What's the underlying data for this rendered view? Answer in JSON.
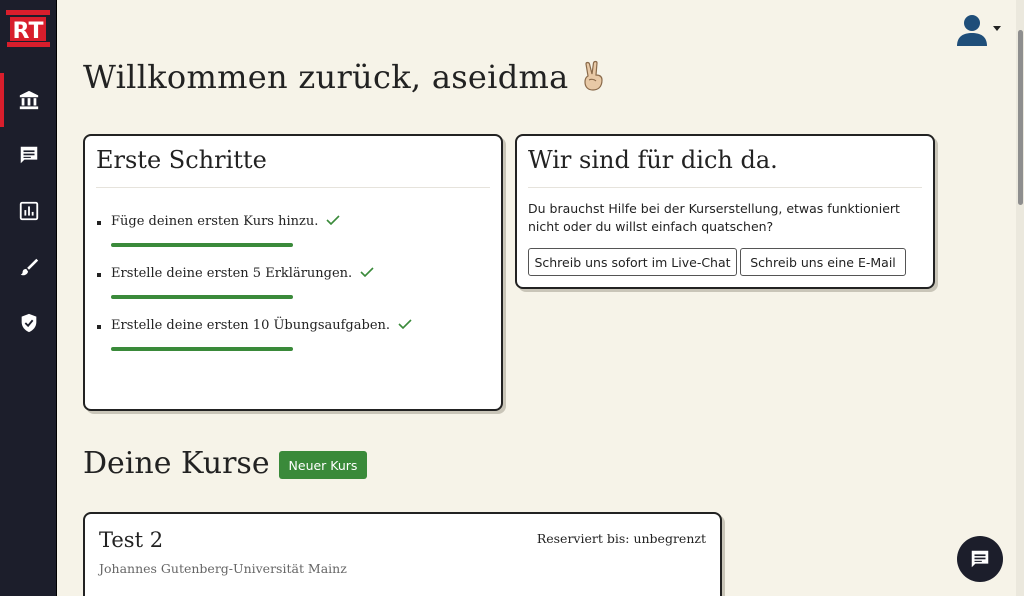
{
  "brand": {
    "logo": "RT",
    "accent_color": "#d81e2c",
    "sidebar_color": "#1c1e2b"
  },
  "sidebar": {
    "items": [
      {
        "icon": "institution-icon",
        "active": true
      },
      {
        "icon": "chat-icon",
        "active": false
      },
      {
        "icon": "chart-icon",
        "active": false
      },
      {
        "icon": "brush-icon",
        "active": false
      },
      {
        "icon": "shield-check-icon",
        "active": false
      }
    ]
  },
  "header": {
    "avatar_icon": "user-icon"
  },
  "welcome": {
    "title": "Willkommen zurück, aseidma",
    "emoji": "✌🏼"
  },
  "getting_started": {
    "title": "Erste Schritte",
    "steps": [
      {
        "label": "Füge deinen ersten Kurs hinzu.",
        "progress": 100
      },
      {
        "label": "Erstelle deine ersten 5 Erklärungen.",
        "progress": 100
      },
      {
        "label": "Erstelle deine ersten 10 Übungsaufgaben.",
        "progress": 100
      }
    ]
  },
  "help": {
    "title": "Wir sind für dich da.",
    "text": "Du brauchst Hilfe bei der Kurserstellung, etwas funktioniert nicht oder du willst einfach quatschen?",
    "live_chat_label": "Schreib uns sofort im Live-Chat",
    "email_label": "Schreib uns eine E-Mail"
  },
  "courses": {
    "title": "Deine Kurse",
    "new_course_label": "Neuer Kurs",
    "items": [
      {
        "title": "Test 2",
        "university": "Johannes Gutenberg-Universität Mainz",
        "reserved": "Reserviert bis: unbegrenzt"
      }
    ]
  },
  "colors": {
    "progress": "#3a8a3a",
    "background": "#f6f3e8"
  }
}
